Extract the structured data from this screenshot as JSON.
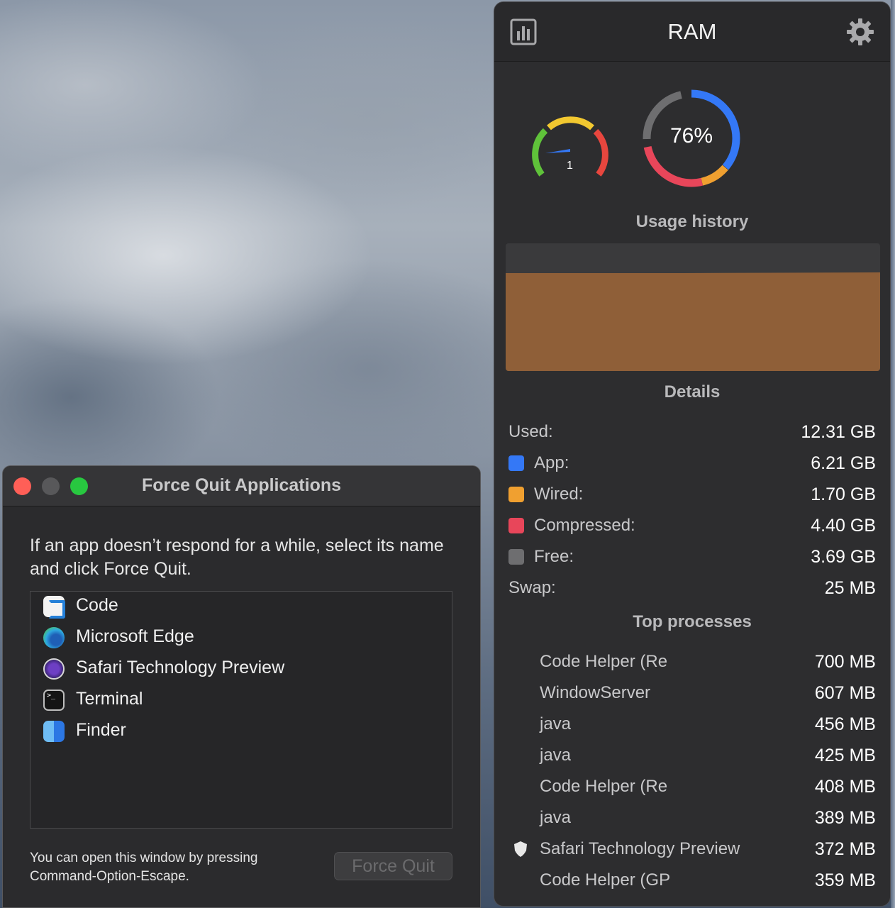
{
  "force_quit": {
    "title": "Force Quit Applications",
    "description": "If an app doesn’t respond for a while, select its name and click Force Quit.",
    "apps": [
      {
        "name": "Code",
        "icon": "vscode-icon"
      },
      {
        "name": "Microsoft Edge",
        "icon": "edge-icon"
      },
      {
        "name": "Safari Technology Preview",
        "icon": "safari-preview-icon"
      },
      {
        "name": "Terminal",
        "icon": "terminal-icon"
      },
      {
        "name": "Finder",
        "icon": "finder-icon"
      }
    ],
    "hint_line1": "You can open this window by pressing",
    "hint_line2": "Command-Option-Escape.",
    "button_label": "Force Quit"
  },
  "ram": {
    "title": "RAM",
    "gauge_value": "1",
    "usage_percent": "76%",
    "usage_history_title": "Usage history",
    "details_title": "Details",
    "details": {
      "used": {
        "label": "Used:",
        "value": "12.31 GB"
      },
      "app": {
        "label": "App:",
        "value": "6.21 GB",
        "color": "#3478f6"
      },
      "wired": {
        "label": "Wired:",
        "value": "1.70 GB",
        "color": "#f0a030"
      },
      "compressed": {
        "label": "Compressed:",
        "value": "4.40 GB",
        "color": "#e8465a"
      },
      "free": {
        "label": "Free:",
        "value": "3.69 GB",
        "color": "#6e6e70"
      },
      "swap": {
        "label": "Swap:",
        "value": "25 MB"
      }
    },
    "top_processes_title": "Top processes",
    "processes": [
      {
        "name": "Code Helper (Re",
        "value": "700 MB"
      },
      {
        "name": "WindowServer",
        "value": "607 MB"
      },
      {
        "name": "java",
        "value": "456 MB"
      },
      {
        "name": "java",
        "value": "425 MB"
      },
      {
        "name": "Code Helper (Re",
        "value": "408 MB"
      },
      {
        "name": "java",
        "value": "389 MB"
      },
      {
        "name": "Safari Technology Preview",
        "value": "372 MB"
      },
      {
        "name": "Code Helper (GP",
        "value": "359 MB"
      }
    ],
    "history_color": "#8f5f38"
  }
}
